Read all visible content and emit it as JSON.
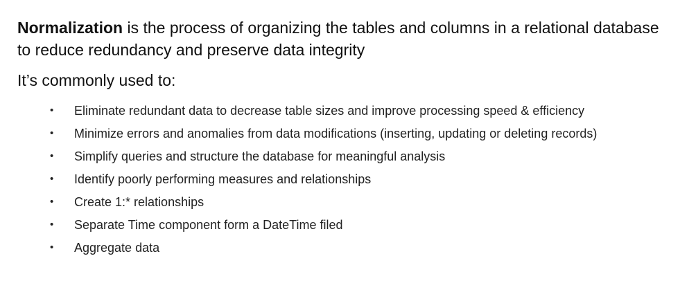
{
  "definition": {
    "term": "Normalization",
    "text": " is the process of organizing the tables and columns in a relational database to reduce redundancy and preserve data integrity"
  },
  "subheading": "It’s commonly used to:",
  "bullets": [
    "Eliminate redundant data to decrease table sizes and improve processing speed & efficiency",
    "Minimize errors and anomalies from data modifications (inserting, updating or deleting records)",
    "Simplify queries and structure the database for meaningful analysis",
    "Identify poorly performing measures and relationships",
    "Create 1:* relationships",
    "Separate Time component form a DateTime filed",
    "Aggregate data"
  ],
  "bullet_glyph": "•"
}
